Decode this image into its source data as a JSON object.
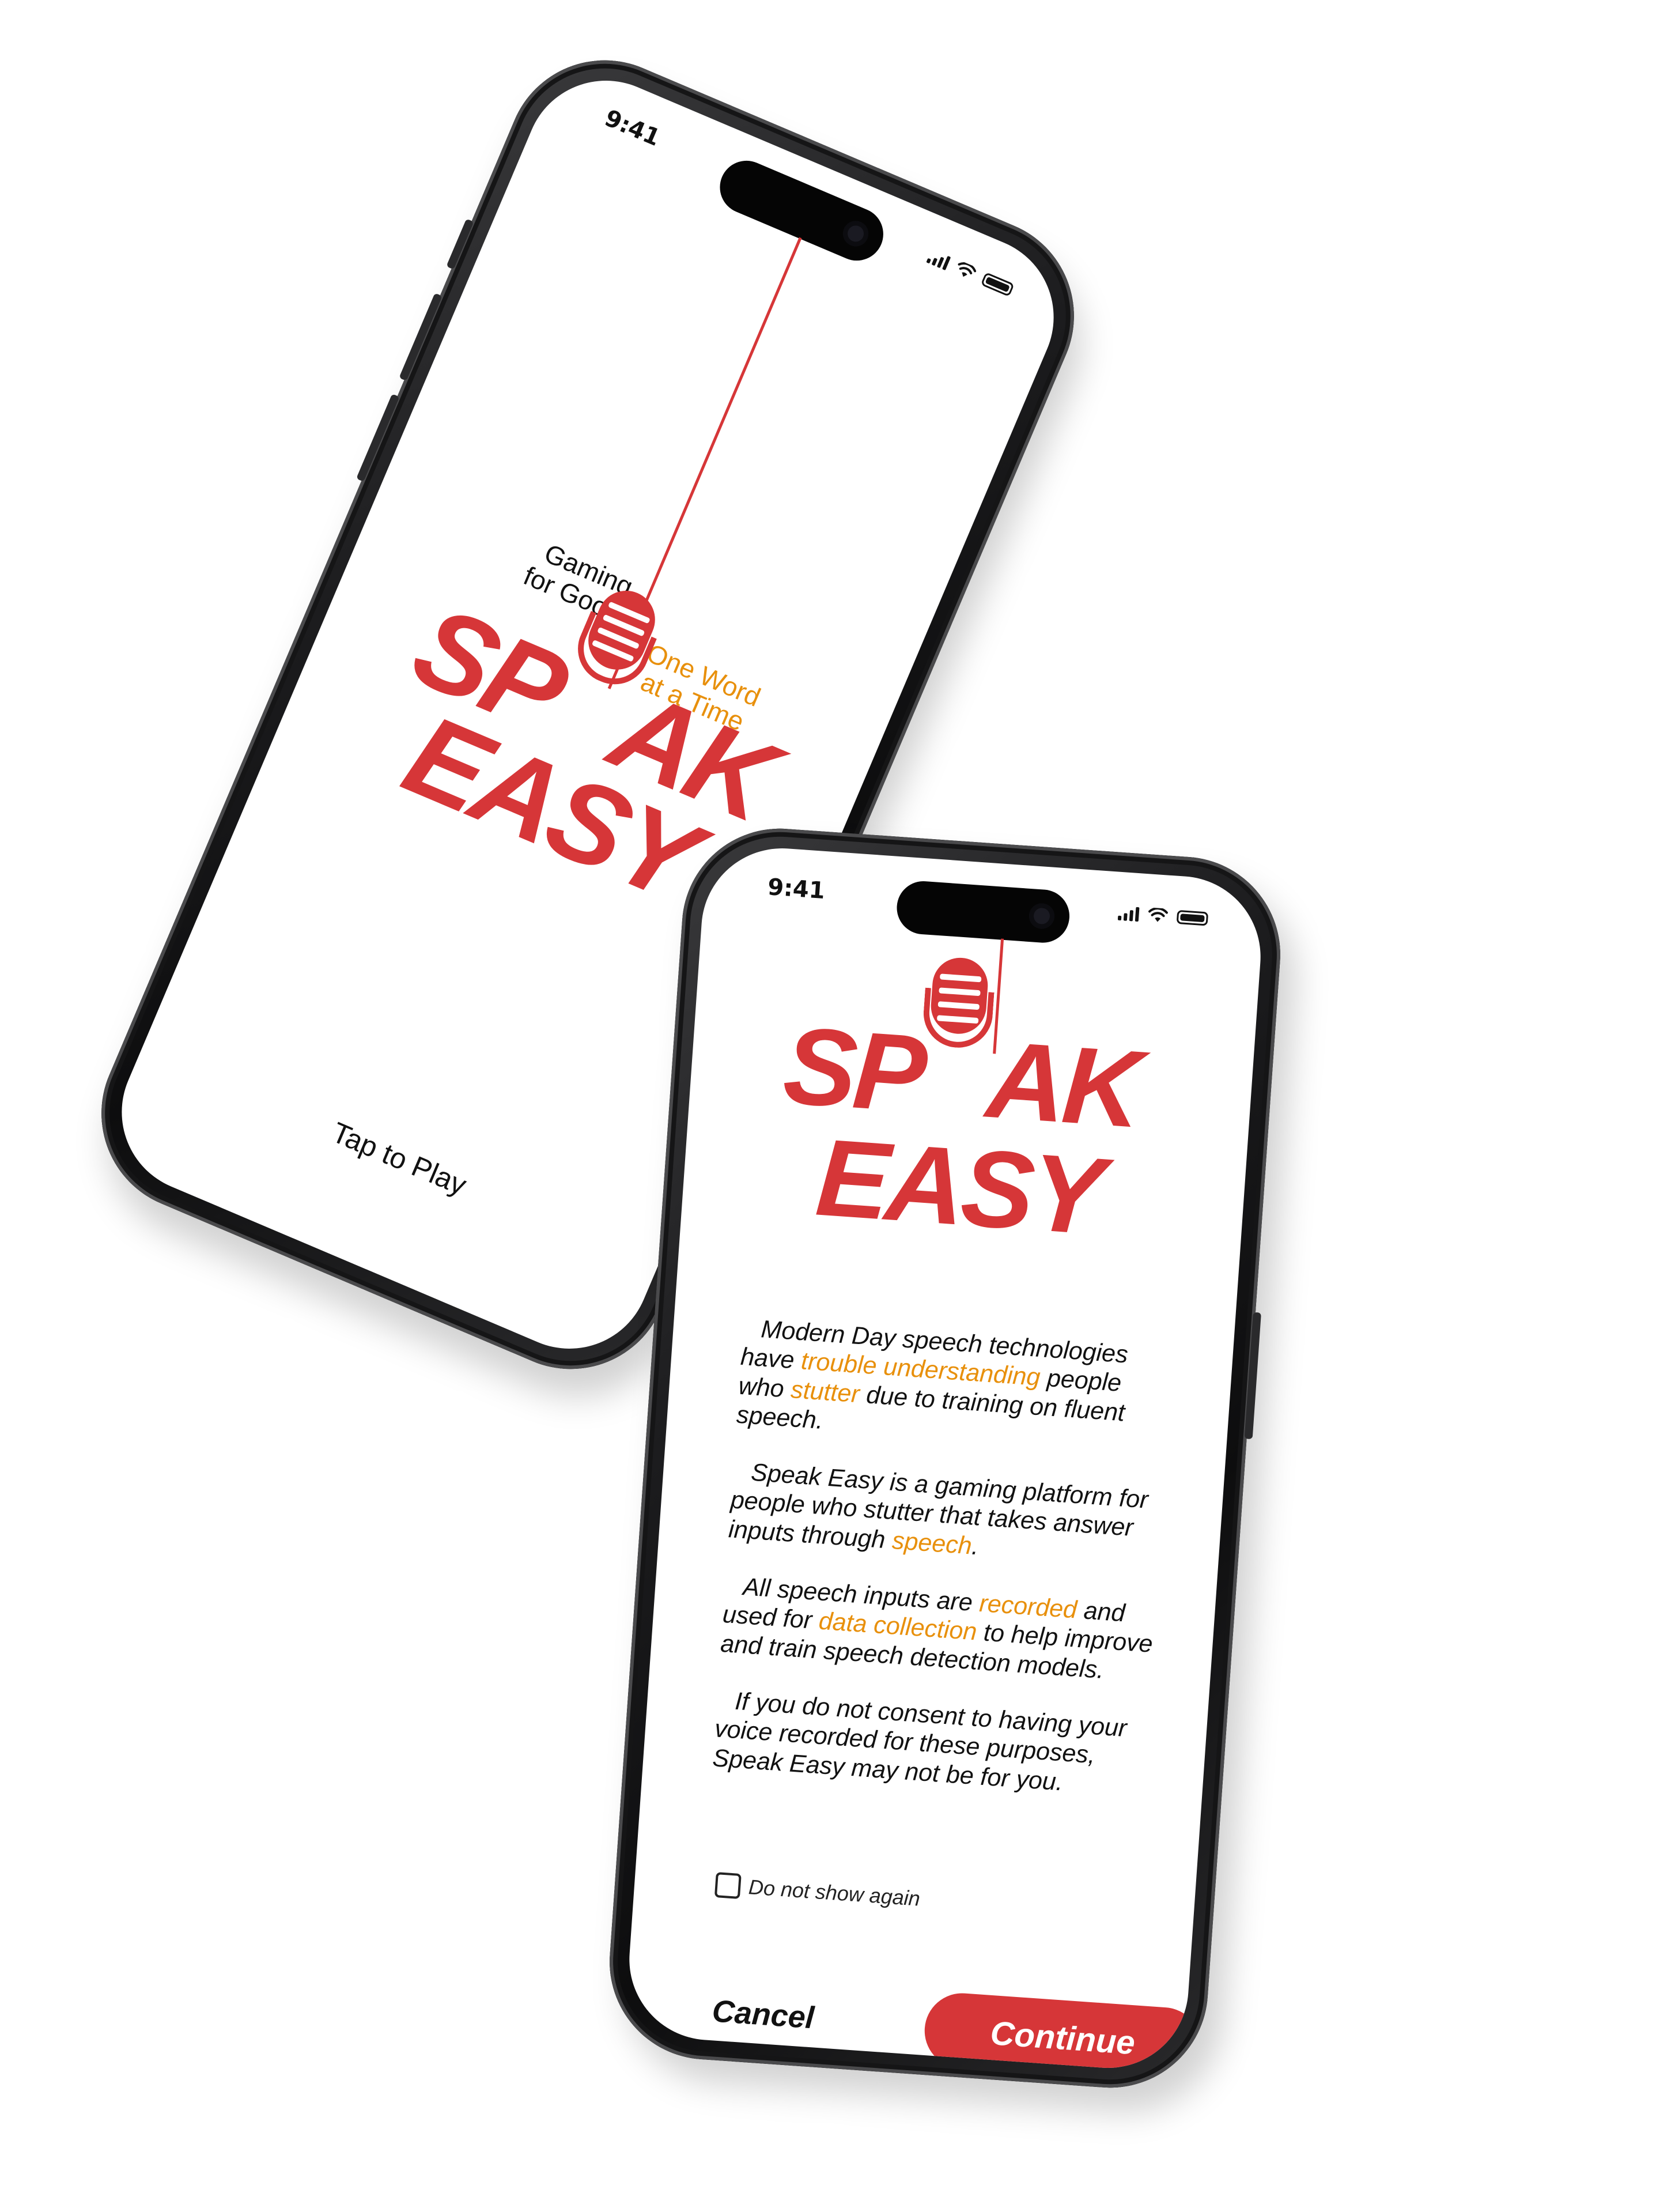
{
  "colors": {
    "brand_red": "#d63638",
    "accent_orange": "#e8900c",
    "text": "#111111"
  },
  "splash_screen": {
    "status_time": "9:41",
    "tagline_left": [
      "Gaming",
      "for Good"
    ],
    "tagline_right": [
      "One Word",
      "at a Time"
    ],
    "logo_line1_before": "SP",
    "logo_line1_after": "AK",
    "logo_line2": "EASY",
    "tap_label": "Tap to Play",
    "icons": [
      "microphone-icon",
      "signal-icon",
      "wifi-icon",
      "battery-icon"
    ]
  },
  "consent_screen": {
    "status_time": "9:41",
    "logo_line1_before": "SP",
    "logo_line1_after": "AK",
    "logo_line2": "EASY",
    "paragraph1": {
      "a": "Modern Day speech technologies have ",
      "b": "trouble understanding",
      "c": " people who ",
      "d": "stutter",
      "e": " due to training on fluent speech."
    },
    "paragraph2": {
      "a": "Speak Easy is a gaming platform for people who stutter that takes answer inputs through ",
      "b": "speech",
      "c": "."
    },
    "paragraph3": {
      "a": "All speech inputs are ",
      "b": "recorded",
      "c": " and used for ",
      "d": "data collection",
      "e": " to help improve and train speech detection models."
    },
    "paragraph4": "If you do not consent to having your voice recorded for these purposes, Speak Easy may not be for you.",
    "checkbox_label": "Do not show again",
    "checkbox_checked": false,
    "cancel_label": "Cancel",
    "continue_label": "Continue"
  }
}
